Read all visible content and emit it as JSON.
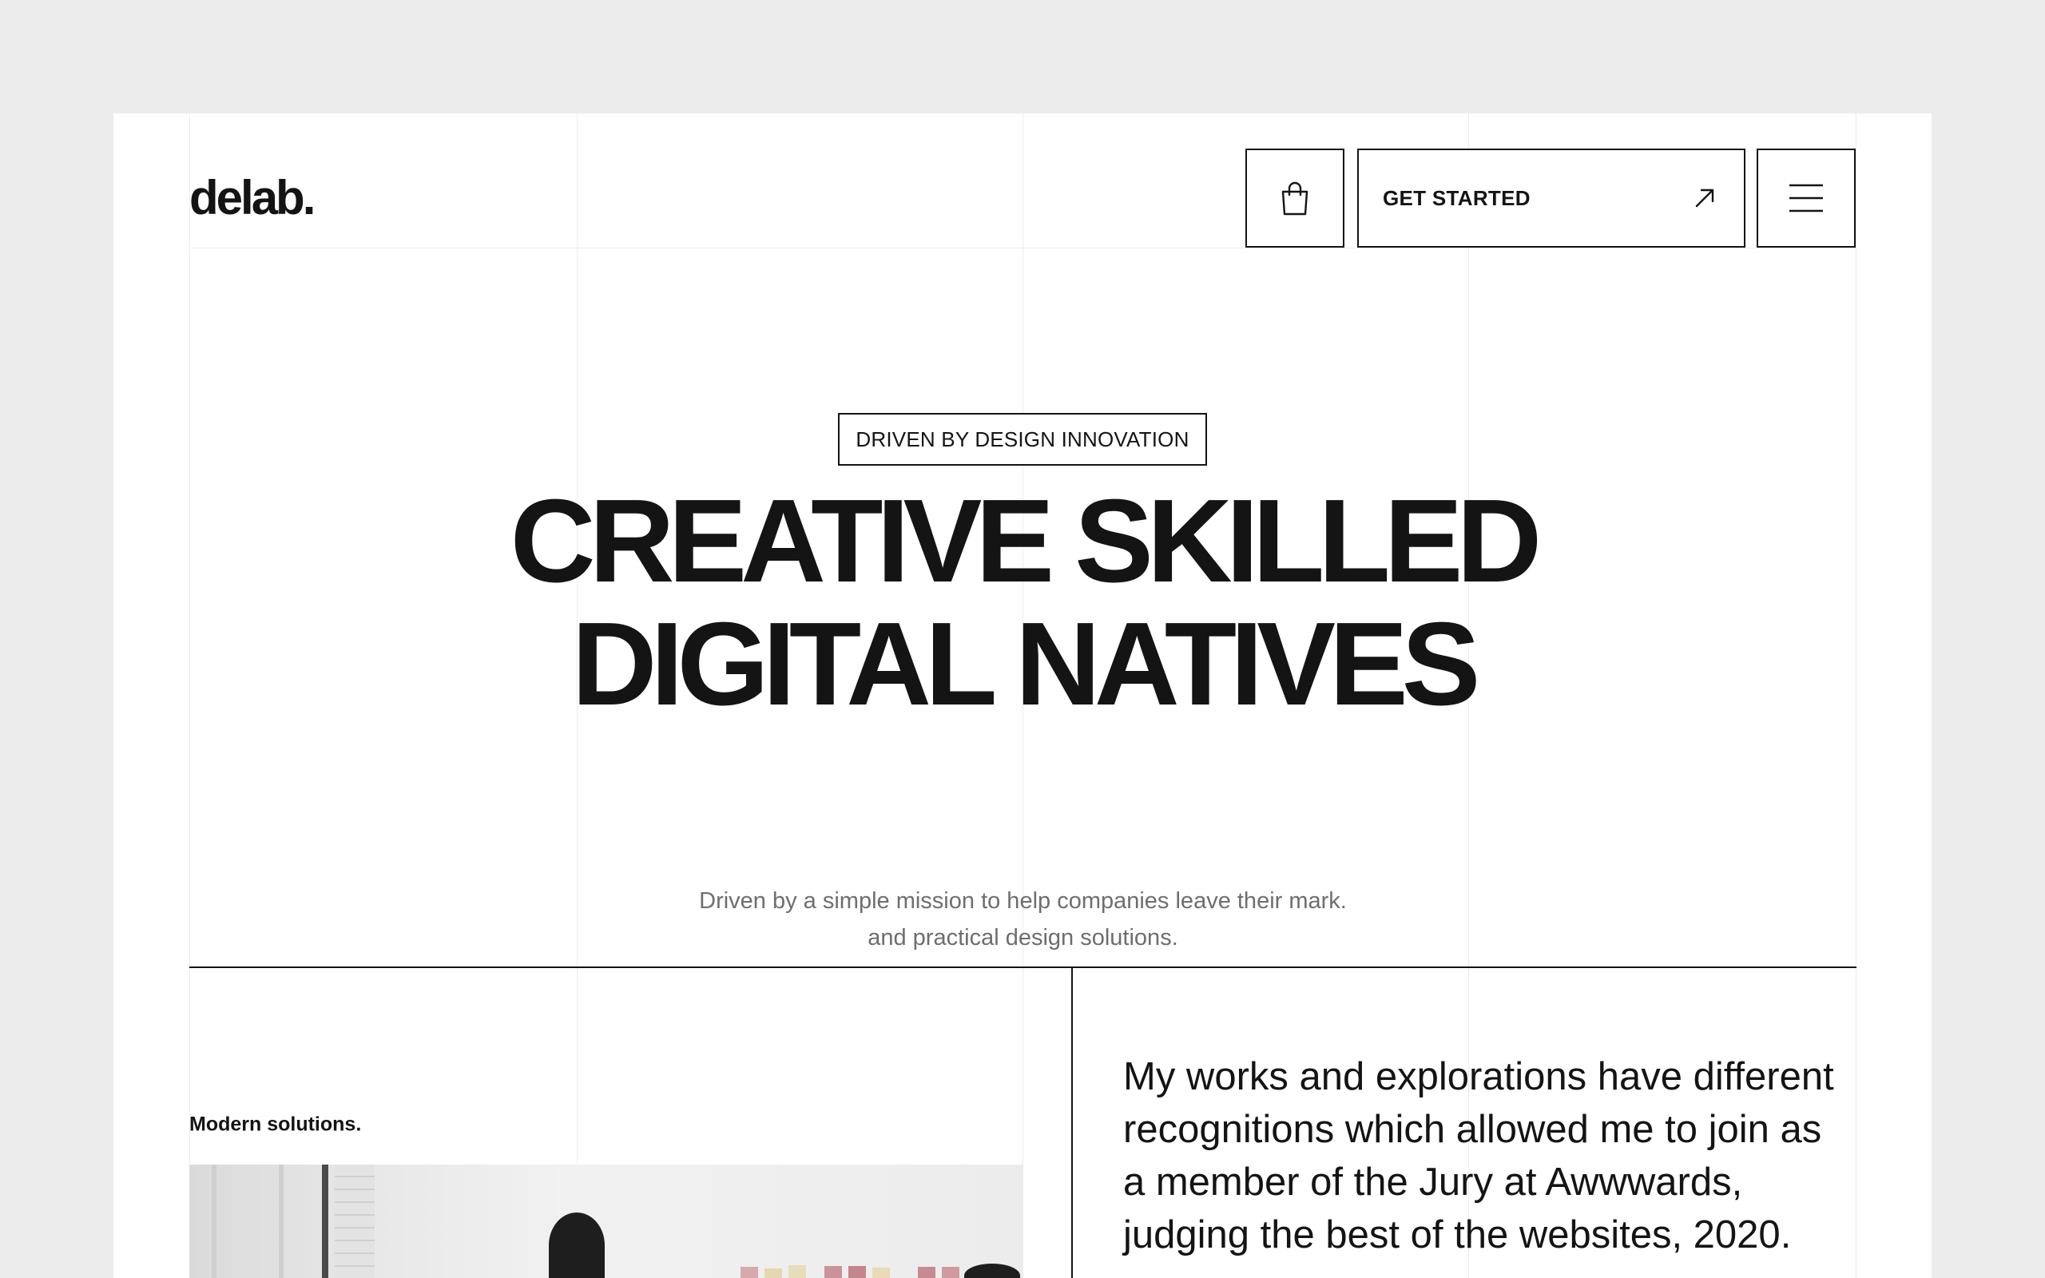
{
  "brand": {
    "logo": "delab."
  },
  "header": {
    "cart_icon": "shopping-bag-icon",
    "cta_label": "GET STARTED",
    "cta_icon": "arrow-up-right-icon",
    "menu_icon": "hamburger-menu-icon"
  },
  "hero": {
    "tagline": "DRIVEN BY DESIGN INNOVATION",
    "headline_line1": "CREATIVE SKILLED",
    "headline_line2": "DIGITAL NATIVES",
    "subtitle_line1": "Driven by a simple mission to help companies leave their mark.",
    "subtitle_line2": "and practical design solutions."
  },
  "section": {
    "label": "Modern solutions.",
    "image_alt": "team collaborating at a wall of sticky notes",
    "quote": "My works and explorations have different recognitions which allowed me to join as a member of the Jury at Awwwards, judging the best of the websites, 2020."
  },
  "colors": {
    "text": "#141414",
    "muted": "#6e6e6e",
    "background": "#ececec",
    "surface": "#ffffff"
  }
}
